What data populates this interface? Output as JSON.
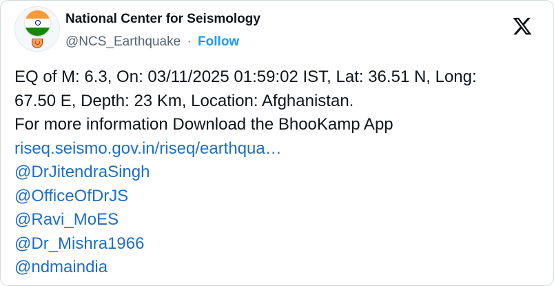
{
  "account": {
    "name": "National Center for Seismology",
    "handle": "@NCS_Earthquake",
    "separator": "·",
    "follow_label": "Follow"
  },
  "icons": {
    "avatar": "india-flag-emblem-avatar",
    "platform": "x-logo-icon"
  },
  "post": {
    "line1": "EQ of M: 6.3, On: 03/11/2025 01:59:02 IST, Lat: 36.51 N, Long:",
    "line2": "67.50 E, Depth: 23 Km, Location: Afghanistan.",
    "line3": "For more information Download the BhooKamp App",
    "link": "riseq.seismo.gov.in/riseq/earthqua…",
    "mentions": [
      "@DrJitendraSingh",
      "@OfficeOfDrJS",
      "@Ravi_MoES",
      "@Dr_Mishra1966",
      "@ndmaindia"
    ]
  },
  "colors": {
    "link": "#1d6ec2",
    "follow": "#1d9bf0",
    "text": "#0f1419",
    "muted": "#536471"
  }
}
